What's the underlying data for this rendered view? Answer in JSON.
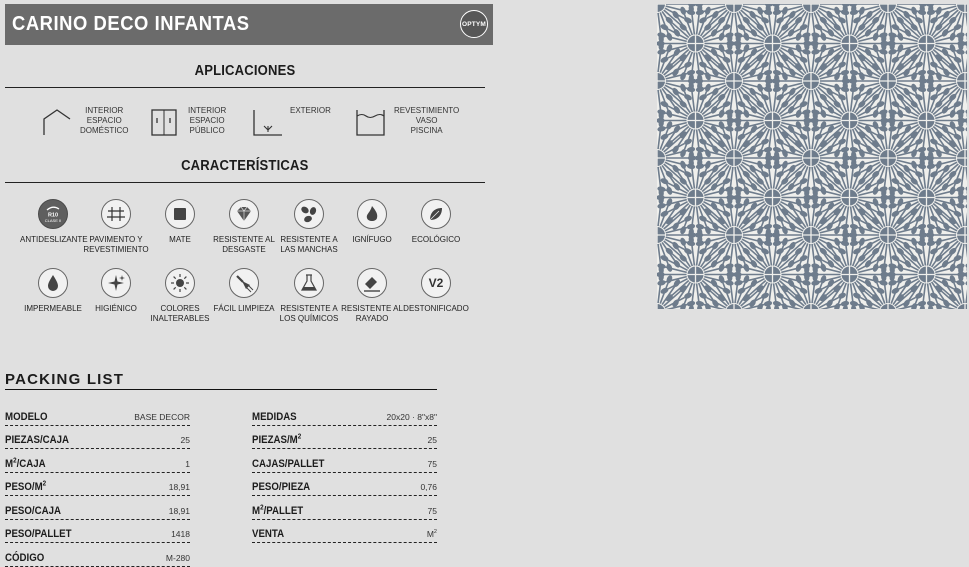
{
  "title": "CARINO DECO INFANTAS",
  "brand_logo": "OPTYM",
  "sections": {
    "aplicaciones": "APLICACIONES",
    "caracteristicas": "CARACTERÍSTICAS",
    "packing_list": "PACKING LIST"
  },
  "applications": [
    {
      "icon": "house-icon",
      "label": "INTERIOR\nESPACIO\nDOMÉSTICO"
    },
    {
      "icon": "building-icon",
      "label": "INTERIOR\nESPACIO\nPÚBLICO"
    },
    {
      "icon": "exterior-icon",
      "label": "EXTERIOR"
    },
    {
      "icon": "pool-icon",
      "label": "REVESTIMIENTO\nVASO\nPISCINA"
    }
  ],
  "features": [
    {
      "icon": "antislip-r10-icon",
      "label": "ANTIDESLIZANTE",
      "badge": "R10\nCLASE II"
    },
    {
      "icon": "floor-wall-icon",
      "label": "PAVIMENTO Y\nREVESTIMIENTO"
    },
    {
      "icon": "matte-icon",
      "label": "MATE"
    },
    {
      "icon": "diamond-icon",
      "label": "RESISTENTE AL\nDESGASTE"
    },
    {
      "icon": "stain-icon",
      "label": "RESISTENTE A\nLAS MANCHAS"
    },
    {
      "icon": "flame-icon",
      "label": "IGNÍFUGO"
    },
    {
      "icon": "leaf-icon",
      "label": "ECOLÓGICO"
    },
    {
      "icon": "drop-icon",
      "label": "IMPERMEABLE"
    },
    {
      "icon": "sparkle-icon",
      "label": "HIGIÉNICO"
    },
    {
      "icon": "sun-icon",
      "label": "COLORES\nINALTERABLES"
    },
    {
      "icon": "brush-icon",
      "label": "FÁCIL LIMPIEZA"
    },
    {
      "icon": "chemical-icon",
      "label": "RESISTENTE A\nLOS QUÍMICOS"
    },
    {
      "icon": "scratch-icon",
      "label": "RESISTENTE AL\nRAYADO"
    },
    {
      "icon": "v2-icon",
      "label": "DESTONIFICADO",
      "badge": "V2"
    }
  ],
  "packing_left": [
    {
      "key": "MODELO",
      "value": "BASE DECOR"
    },
    {
      "key": "PIEZAS/CAJA",
      "value": "25"
    },
    {
      "key": "M2/CAJA",
      "value": "1"
    },
    {
      "key": "PESO/M2",
      "value": "18,91"
    },
    {
      "key": "PESO/CAJA",
      "value": "18,91"
    },
    {
      "key": "PESO/PALLET",
      "value": "1418"
    },
    {
      "key": "CÓDIGO",
      "value": "M-280"
    }
  ],
  "packing_right": [
    {
      "key": "MEDIDAS",
      "value": "20x20 · 8\"x8\""
    },
    {
      "key": "PIEZAS/M2",
      "value": "25"
    },
    {
      "key": "CAJAS/PALLET",
      "value": "75"
    },
    {
      "key": "PESO/PIEZA",
      "value": "0,76"
    },
    {
      "key": "M2/PALLET",
      "value": "75"
    },
    {
      "key": "VENTA",
      "value": "M2"
    }
  ],
  "colors": {
    "title_bar": "#6b6b6b",
    "background": "#e0e0e0",
    "tile_base": "#efefec",
    "tile_pattern": "#6e7c8c"
  }
}
